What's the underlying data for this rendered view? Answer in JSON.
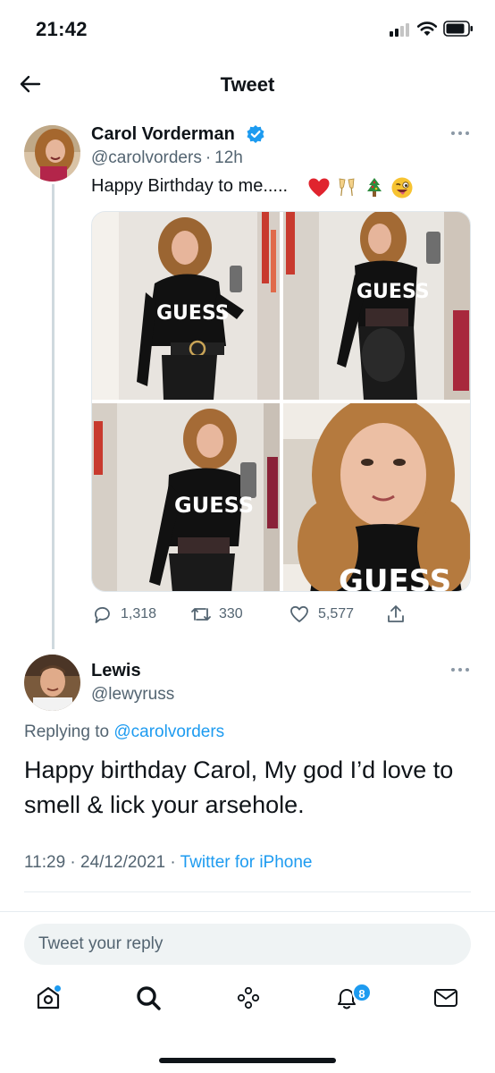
{
  "status_bar": {
    "time": "21:42"
  },
  "header": {
    "title": "Tweet"
  },
  "main_tweet": {
    "author_name": "Carol Vorderman",
    "handle": "@carolvorders",
    "time_sep": "·",
    "age": "12h",
    "text": "Happy Birthday to me.....",
    "emojis": [
      "heart",
      "champagne-glasses",
      "christmas-tree",
      "winking-face"
    ],
    "photos": [
      {
        "id": "photo-1",
        "alt_name": "black-guess-top-mirror-selfie"
      },
      {
        "id": "photo-2",
        "alt_name": "guess-top-side-pose"
      },
      {
        "id": "photo-3",
        "alt_name": "guess-top-mirror-selfie"
      },
      {
        "id": "photo-4",
        "alt_name": "face-selfie"
      }
    ],
    "actions": {
      "replies": "1,318",
      "retweets": "330",
      "likes": "5,577"
    }
  },
  "reply_tweet": {
    "author_name": "Lewis",
    "handle": "@lewyruss",
    "replying_to_label": "Replying to",
    "replying_to_handle": "@carolvorders",
    "text": "Happy birthday Carol, My god I’d love to smell & lick your arsehole.",
    "date_time": "11:29 · 24/12/2021 · ",
    "source": "Twitter for iPhone"
  },
  "reply_bar": {
    "placeholder": "Tweet your reply"
  },
  "bottom_nav": {
    "notifications_badge": "8"
  },
  "colors": {
    "accent": "#1d9bf0",
    "text": "#0f1419",
    "secondary": "#536471"
  }
}
